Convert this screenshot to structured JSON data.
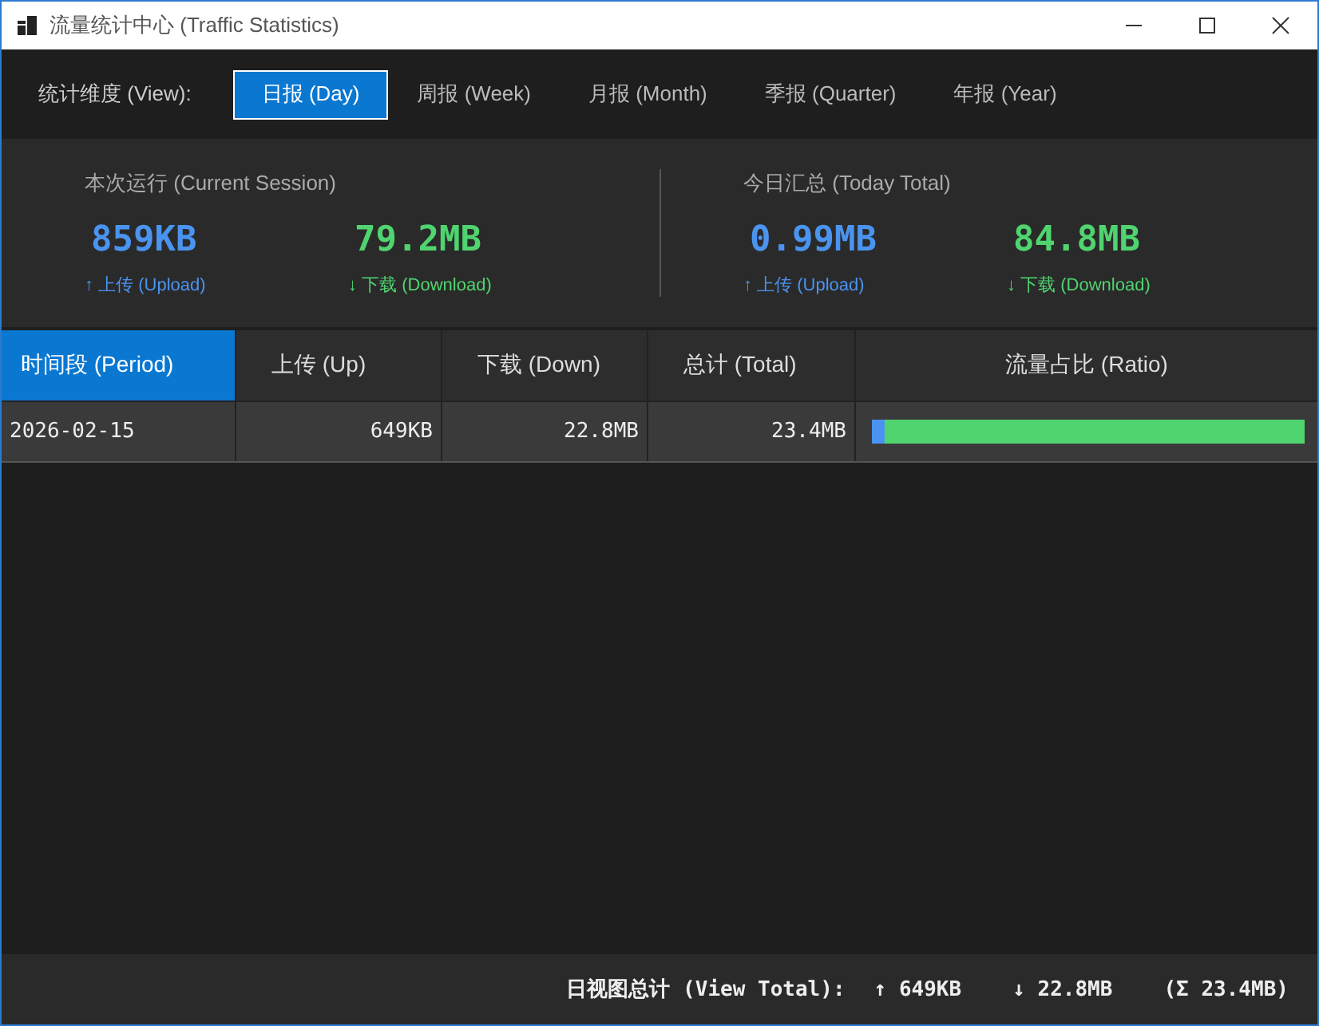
{
  "window": {
    "title": "流量统计中心 (Traffic Statistics)"
  },
  "view_bar": {
    "label": "统计维度 (View):",
    "tabs": [
      {
        "label": "日报 (Day)",
        "selected": true
      },
      {
        "label": "周报 (Week)",
        "selected": false
      },
      {
        "label": "月报 (Month)",
        "selected": false
      },
      {
        "label": "季报 (Quarter)",
        "selected": false
      },
      {
        "label": "年报 (Year)",
        "selected": false
      }
    ]
  },
  "summary": [
    {
      "title": "本次运行 (Current Session)",
      "stats": [
        {
          "kind": "upload",
          "value": "859KB",
          "label": "↑ 上传 (Upload)"
        },
        {
          "kind": "download",
          "value": "79.2MB",
          "label": "↓ 下载 (Download)"
        }
      ]
    },
    {
      "title": "今日汇总 (Today Total)",
      "stats": [
        {
          "kind": "upload",
          "value": "0.99MB",
          "label": "↑ 上传 (Upload)"
        },
        {
          "kind": "download",
          "value": "84.8MB",
          "label": "↓ 下载 (Download)"
        }
      ]
    }
  ],
  "table": {
    "columns": [
      {
        "label": "时间段 (Period)",
        "selected": true
      },
      {
        "label": "上传 (Up)",
        "selected": false
      },
      {
        "label": "下载 (Down)",
        "selected": false
      },
      {
        "label": "总计 (Total)",
        "selected": false
      },
      {
        "label": "流量占比 (Ratio)",
        "selected": false
      }
    ],
    "rows": [
      {
        "period": "2026-02-15",
        "up": "649KB",
        "down": "22.8MB",
        "total": "23.4MB",
        "level": 0.028
      }
    ]
  },
  "status_bar": {
    "label": "日视图总计 (View Total):",
    "up": "↑ 649KB",
    "down": "↓ 22.8MB",
    "total": "(Σ 23.4MB)"
  }
}
